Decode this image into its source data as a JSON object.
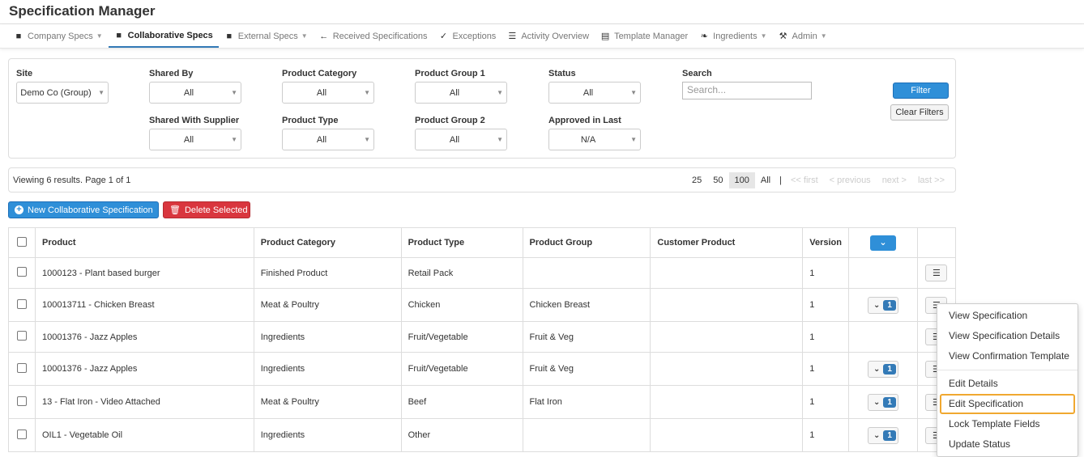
{
  "app": {
    "title": "Specification Manager"
  },
  "nav": [
    {
      "label": "Company Specs",
      "icon": "briefcase-icon",
      "glyph": "■",
      "caret": true,
      "active": false
    },
    {
      "label": "Collaborative Specs",
      "icon": "briefcase-icon",
      "glyph": "■",
      "caret": false,
      "active": true
    },
    {
      "label": "External Specs",
      "icon": "briefcase-icon",
      "glyph": "■",
      "caret": true,
      "active": false
    },
    {
      "label": "Received Specifications",
      "icon": "arrow-left-icon",
      "glyph": "←",
      "caret": false,
      "active": false
    },
    {
      "label": "Exceptions",
      "icon": "check-circle-icon",
      "glyph": "✓",
      "caret": false,
      "active": false
    },
    {
      "label": "Activity Overview",
      "icon": "list-icon",
      "glyph": "☰",
      "caret": false,
      "active": false
    },
    {
      "label": "Template Manager",
      "icon": "document-icon",
      "glyph": "▤",
      "caret": false,
      "active": false
    },
    {
      "label": "Ingredients",
      "icon": "leaf-icon",
      "glyph": "❧",
      "caret": true,
      "active": false
    },
    {
      "label": "Admin",
      "icon": "wrench-icon",
      "glyph": "⚒",
      "caret": true,
      "active": false
    }
  ],
  "filters": {
    "site": {
      "label": "Site",
      "value": "Demo Co (Group)"
    },
    "shared_by": {
      "label": "Shared By",
      "value": "All"
    },
    "product_category": {
      "label": "Product Category",
      "value": "All"
    },
    "product_group_1": {
      "label": "Product Group 1",
      "value": "All"
    },
    "status": {
      "label": "Status",
      "value": "All"
    },
    "search": {
      "label": "Search",
      "placeholder": "Search..."
    },
    "shared_with_supplier": {
      "label": "Shared With Supplier",
      "value": "All"
    },
    "product_type": {
      "label": "Product Type",
      "value": "All"
    },
    "product_group_2": {
      "label": "Product Group 2",
      "value": "All"
    },
    "approved_in_last": {
      "label": "Approved in Last",
      "value": "N/A"
    },
    "filter_button": "Filter",
    "clear_button": "Clear Filters"
  },
  "pager": {
    "summary": "Viewing 6 results. Page 1 of 1",
    "sizes": [
      "25",
      "50",
      "100",
      "All"
    ],
    "separator": "|",
    "first": "<< first",
    "previous": "< previous",
    "next": "next >",
    "last": "last >>"
  },
  "actions": {
    "new": "New Collaborative Specification",
    "delete": "Delete Selected"
  },
  "table": {
    "headers": [
      "Product",
      "Product Category",
      "Product Type",
      "Product Group",
      "Customer Product",
      "Version"
    ],
    "rows": [
      {
        "product": "1000123 - Plant based burger",
        "category": "Finished Product",
        "type": "Retail Pack",
        "group": "",
        "customer": "",
        "version": "1",
        "badge": ""
      },
      {
        "product": "100013711 - Chicken Breast",
        "category": "Meat & Poultry",
        "type": "Chicken",
        "group": "Chicken Breast",
        "customer": "",
        "version": "1",
        "badge": "1"
      },
      {
        "product": "10001376 - Jazz Apples",
        "category": "Ingredients",
        "type": "Fruit/Vegetable",
        "group": "Fruit & Veg",
        "customer": "",
        "version": "1",
        "badge": ""
      },
      {
        "product": "10001376 - Jazz Apples",
        "category": "Ingredients",
        "type": "Fruit/Vegetable",
        "group": "Fruit & Veg",
        "customer": "",
        "version": "1",
        "badge": "1"
      },
      {
        "product": "13 - Flat Iron - Video Attached",
        "category": "Meat & Poultry",
        "type": "Beef",
        "group": "Flat Iron",
        "customer": "",
        "version": "1",
        "badge": "1"
      },
      {
        "product": "OIL1 - Vegetable Oil",
        "category": "Ingredients",
        "type": "Other",
        "group": "",
        "customer": "",
        "version": "1",
        "badge": "1"
      }
    ]
  },
  "menu": {
    "items": [
      "View Specification",
      "View Specification Details",
      "View Confirmation Template",
      "Edit Details",
      "Edit Specification",
      "Lock Template Fields",
      "Update Status"
    ],
    "highlighted": "Edit Specification"
  }
}
